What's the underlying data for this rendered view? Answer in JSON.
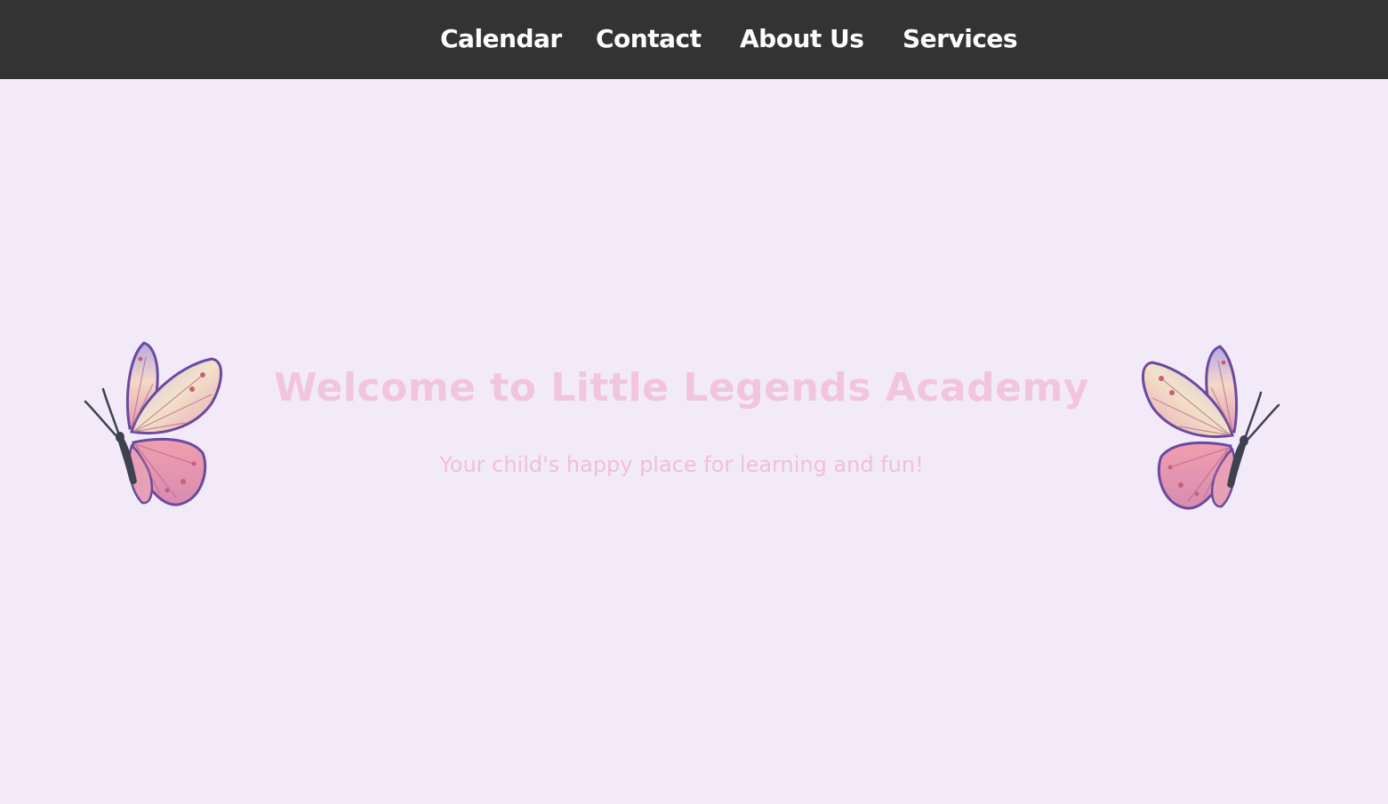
{
  "nav": {
    "items": [
      {
        "label": "Calendar"
      },
      {
        "label": "Contact"
      },
      {
        "label": "About Us"
      },
      {
        "label": "Services"
      }
    ]
  },
  "hero": {
    "title": "Welcome to Little Legends Academy",
    "subtitle": "Your child's happy place for learning and fun!"
  },
  "decor": {
    "left_icon": "butterfly-icon",
    "right_icon": "butterfly-icon"
  },
  "colors": {
    "nav_background": "#333333",
    "nav_text": "#ffffff",
    "page_background": "#f3eaf9",
    "hero_text": "#f2c5df"
  }
}
